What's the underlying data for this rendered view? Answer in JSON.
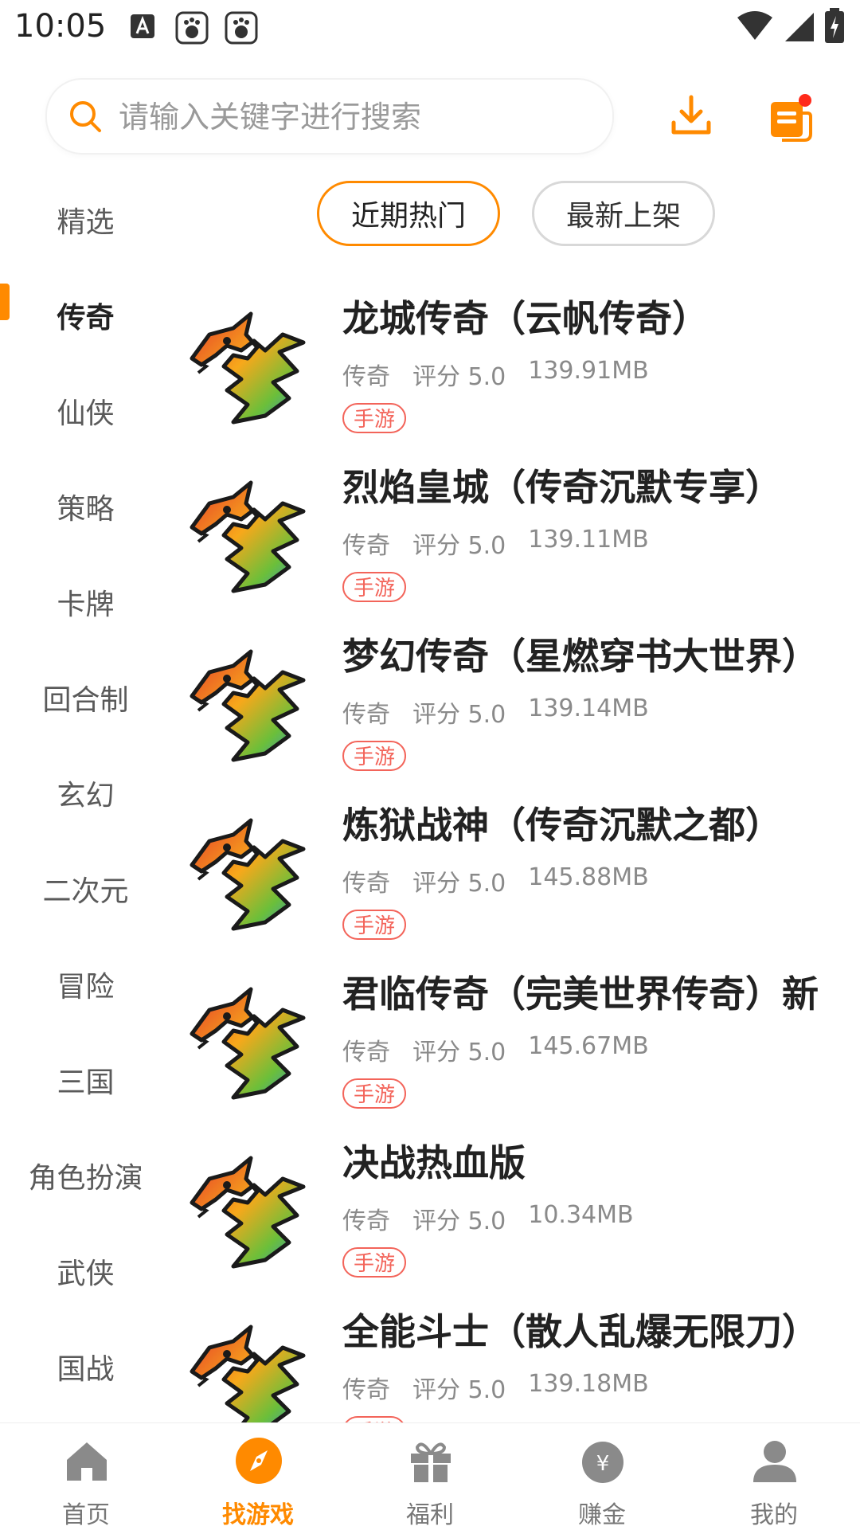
{
  "status_bar": {
    "time": "10:05"
  },
  "search": {
    "placeholder": "请输入关键字进行搜索"
  },
  "sidebar": {
    "items": [
      {
        "label": "精选"
      },
      {
        "label": "传奇"
      },
      {
        "label": "仙侠"
      },
      {
        "label": "策略"
      },
      {
        "label": "卡牌"
      },
      {
        "label": "回合制"
      },
      {
        "label": "玄幻"
      },
      {
        "label": "二次元"
      },
      {
        "label": "冒险"
      },
      {
        "label": "三国"
      },
      {
        "label": "角色扮演"
      },
      {
        "label": "武侠"
      },
      {
        "label": "国战"
      }
    ],
    "active": "传奇"
  },
  "tabs": [
    {
      "label": "近期热门",
      "active": true
    },
    {
      "label": "最新上架",
      "active": false
    }
  ],
  "games": [
    {
      "title": "龙城传奇（云帆传奇）",
      "category": "传奇",
      "rating": "评分 5.0",
      "size": "139.91MB",
      "tag": "手游"
    },
    {
      "title": "烈焰皇城（传奇沉默专享）",
      "category": "传奇",
      "rating": "评分 5.0",
      "size": "139.11MB",
      "tag": "手游"
    },
    {
      "title": "梦幻传奇（星燃穿书大世界）",
      "category": "传奇",
      "rating": "评分 5.0",
      "size": "139.14MB",
      "tag": "手游"
    },
    {
      "title": "炼狱战神（传奇沉默之都）",
      "category": "传奇",
      "rating": "评分 5.0",
      "size": "145.88MB",
      "tag": "手游"
    },
    {
      "title": "君临传奇（完美世界传奇）新",
      "category": "传奇",
      "rating": "评分 5.0",
      "size": "145.67MB",
      "tag": "手游"
    },
    {
      "title": "决战热血版",
      "category": "传奇",
      "rating": "评分 5.0",
      "size": "10.34MB",
      "tag": "手游"
    },
    {
      "title": "全能斗士（散人乱爆无限刀）",
      "category": "传奇",
      "rating": "评分 5.0",
      "size": "139.18MB",
      "tag": "手游"
    }
  ],
  "bottom_nav": [
    {
      "label": "首页",
      "icon": "home-icon"
    },
    {
      "label": "找游戏",
      "icon": "compass-icon",
      "active": true
    },
    {
      "label": "福利",
      "icon": "gift-icon"
    },
    {
      "label": "赚金",
      "icon": "money-bag-icon"
    },
    {
      "label": "我的",
      "icon": "user-icon"
    }
  ],
  "colors": {
    "accent": "#ff8a00",
    "tag": "#f3645a",
    "badge": "#ff2a1a"
  }
}
